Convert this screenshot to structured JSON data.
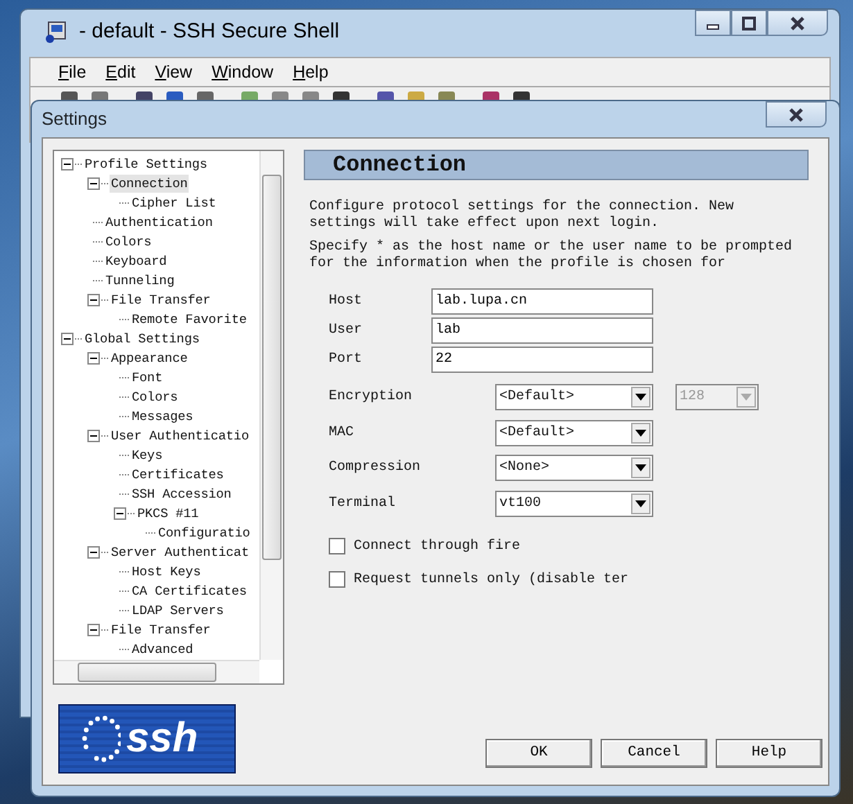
{
  "main_window": {
    "title": "- default - SSH Secure Shell",
    "menu": [
      "File",
      "Edit",
      "View",
      "Window",
      "Help"
    ]
  },
  "dialog": {
    "title": "Settings",
    "tree": [
      {
        "label": "Profile Settings",
        "selected": false,
        "expanded": true,
        "children": [
          {
            "label": "Connection",
            "selected": true,
            "expanded": true,
            "children": [
              {
                "label": "Cipher List",
                "selected": false
              }
            ]
          },
          {
            "label": "Authentication",
            "selected": false
          },
          {
            "label": "Colors",
            "selected": false
          },
          {
            "label": "Keyboard",
            "selected": false
          },
          {
            "label": "Tunneling",
            "selected": false
          },
          {
            "label": "File Transfer",
            "selected": false,
            "expanded": true,
            "children": [
              {
                "label": "Remote Favorite",
                "selected": false
              }
            ]
          }
        ]
      },
      {
        "label": "Global Settings",
        "selected": false,
        "expanded": true,
        "children": [
          {
            "label": "Appearance",
            "selected": false,
            "expanded": true,
            "children": [
              {
                "label": "Font",
                "selected": false
              },
              {
                "label": "Colors",
                "selected": false
              },
              {
                "label": "Messages",
                "selected": false
              }
            ]
          },
          {
            "label": "User Authenticatio",
            "selected": false,
            "expanded": true,
            "children": [
              {
                "label": "Keys",
                "selected": false
              },
              {
                "label": "Certificates",
                "selected": false
              },
              {
                "label": "SSH Accession",
                "selected": false
              },
              {
                "label": "PKCS #11",
                "selected": false,
                "expanded": true,
                "children": [
                  {
                    "label": "Configuratio",
                    "selected": false
                  }
                ]
              }
            ]
          },
          {
            "label": "Server Authenticat",
            "selected": false,
            "expanded": true,
            "children": [
              {
                "label": "Host Keys",
                "selected": false
              },
              {
                "label": "CA Certificates",
                "selected": false
              },
              {
                "label": "LDAP Servers",
                "selected": false
              }
            ]
          },
          {
            "label": "File Transfer",
            "selected": false,
            "expanded": true,
            "children": [
              {
                "label": "Advanced",
                "selected": false
              }
            ]
          }
        ]
      }
    ],
    "panel": {
      "heading": "Connection",
      "descriptions": [
        "Configure protocol settings for the connection. New settings will take effect upon next login.",
        "Specify * as the host name or the user name to be prompted for the information when the profile is chosen for"
      ],
      "fields": [
        {
          "label": "Host",
          "value": "lab.lupa.cn"
        },
        {
          "label": "User",
          "value": "lab"
        },
        {
          "label": "Port",
          "value": "22"
        }
      ],
      "selects": [
        {
          "label": "Encryption",
          "value": "<Default>",
          "extra": {
            "value": "128",
            "disabled": true
          }
        },
        {
          "label": "MAC",
          "value": "<Default>"
        },
        {
          "label": "Compression",
          "value": "<None>"
        },
        {
          "label": "Terminal",
          "value": "vt100"
        }
      ],
      "checkboxes": [
        {
          "label": "Connect through fire",
          "checked": false
        },
        {
          "label": "Request tunnels only (disable ter",
          "checked": false
        }
      ]
    },
    "logo": "ssh",
    "buttons": [
      "OK",
      "Cancel",
      "Help"
    ]
  }
}
